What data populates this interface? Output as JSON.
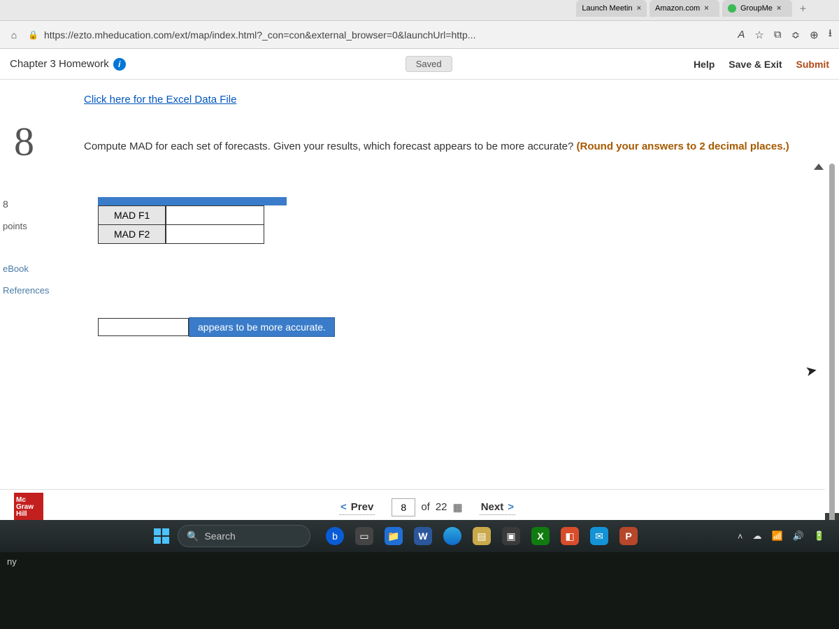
{
  "browser": {
    "tabs": [
      {
        "label": "Launch Meetin"
      },
      {
        "label": "Amazon.com"
      },
      {
        "label": "GroupMe"
      }
    ],
    "url": "https://ezto.mheducation.com/ext/map/index.html?_con=con&external_browser=0&launchUrl=http...",
    "read_aloud": "A"
  },
  "assignment": {
    "title": "Chapter 3 Homework",
    "saved_label": "Saved",
    "help_label": "Help",
    "save_exit_label": "Save & Exit",
    "submit_label": "Submit"
  },
  "content": {
    "excel_link": "Click here for the Excel Data File",
    "question_number": "8",
    "instruction_plain": "Compute MAD for each set of forecasts. Given your results, which forecast appears to be more accurate? ",
    "instruction_hint": "(Round your answers to 2 decimal places.)",
    "sidebar": {
      "points_num": "8",
      "points_label": "points",
      "ebook_label": "eBook",
      "references_label": "References"
    },
    "table": {
      "rows": [
        {
          "label": "MAD F1",
          "value": ""
        },
        {
          "label": "MAD F2",
          "value": ""
        }
      ]
    },
    "accuracy": {
      "value": "",
      "label": "appears to be more accurate."
    }
  },
  "pager": {
    "prev_label": "Prev",
    "current": "8",
    "of_label": "of",
    "total": "22",
    "next_label": "Next"
  },
  "logo": {
    "line1": "Mc",
    "line2": "Graw",
    "line3": "Hill"
  },
  "taskbar": {
    "search_placeholder": "Search"
  },
  "footer_text": "ny"
}
